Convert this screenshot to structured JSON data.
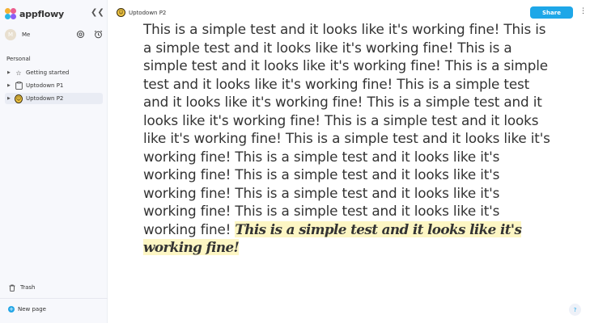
{
  "app": {
    "name": "appflowy"
  },
  "user": {
    "initial": "M",
    "name": "Me"
  },
  "sidebar": {
    "section": "Personal",
    "items": [
      {
        "label": "Getting started",
        "icon": "star-icon"
      },
      {
        "label": "Uptodown P1",
        "icon": "clipboard-icon"
      },
      {
        "label": "Uptodown P2",
        "icon": "grinning-face-icon"
      }
    ],
    "trash_label": "Trash",
    "new_page_label": "New page"
  },
  "header": {
    "title": "Uptodown P2",
    "share_label": "Share",
    "more_label": "⋮"
  },
  "document": {
    "body": "This is a simple test and it looks like it's working fine! This is a simple test and it looks like it's working fine! This is a simple test and it looks like it's working fine! This is a simple test and it looks like it's working fine! This is a simple test and it looks like it's working fine! This is a simple test and it looks like it's working fine! This is a simple test and it looks like it's working fine! This is a simple test and it looks like it's working fine! This is a simple test and it looks like it's working fine! This is a simple test and it looks like it's working fine! This is a simple test and it looks like it's working fine! This is a simple test and it looks like it's working fine! ",
    "highlight": "This is a simple test and it looks like it's working fine!"
  },
  "help_label": "?",
  "colors": {
    "accent": "#1ea7e8",
    "highlight": "#fdf6c4",
    "sidebar_bg": "#f7f8fc"
  }
}
